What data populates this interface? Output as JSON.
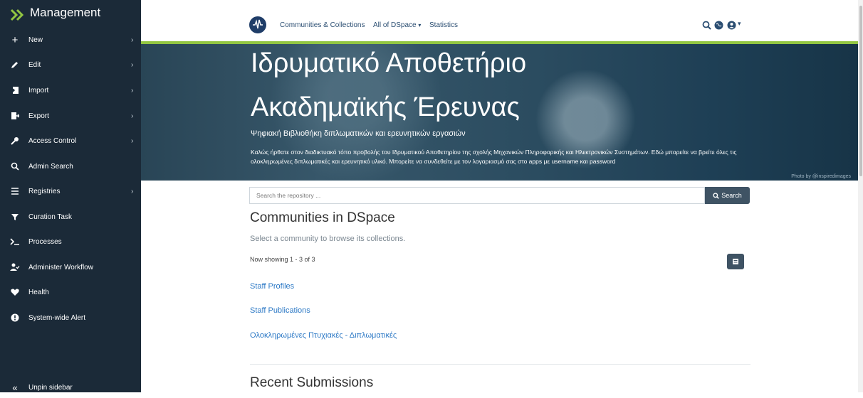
{
  "sidebar": {
    "title": "Management",
    "items": [
      {
        "label": "New",
        "icon": "plus-icon",
        "has_submenu": true
      },
      {
        "label": "Edit",
        "icon": "pencil-icon",
        "has_submenu": true
      },
      {
        "label": "Import",
        "icon": "import-icon",
        "has_submenu": true
      },
      {
        "label": "Export",
        "icon": "export-icon",
        "has_submenu": true
      },
      {
        "label": "Access Control",
        "icon": "key-icon",
        "has_submenu": true
      },
      {
        "label": "Admin Search",
        "icon": "search-icon",
        "has_submenu": false
      },
      {
        "label": "Registries",
        "icon": "list-icon",
        "has_submenu": true
      },
      {
        "label": "Curation Task",
        "icon": "filter-icon",
        "has_submenu": false
      },
      {
        "label": "Processes",
        "icon": "terminal-icon",
        "has_submenu": false
      },
      {
        "label": "Administer Workflow",
        "icon": "user-check-icon",
        "has_submenu": false
      },
      {
        "label": "Health",
        "icon": "heartbeat-icon",
        "has_submenu": false
      },
      {
        "label": "System-wide Alert",
        "icon": "alert-circle-icon",
        "has_submenu": false
      }
    ],
    "unpin_label": "Unpin sidebar",
    "chevron": "›"
  },
  "navbar": {
    "links": [
      "Communities & Collections",
      "All of DSpace",
      "Statistics"
    ],
    "dropdown_caret": "▾"
  },
  "banner": {
    "title_line1": "Ιδρυματικό Αποθετήριο",
    "title_line2": "Ακαδημαϊκής Έρευνας",
    "subtitle": "Ψηφιακή Βιβλιοθήκη διπλωματικών και ερευνητικών εργασιών",
    "welcome": "Καλώς ήρθατε στον διαδικτυακό τόπο προβολής του Ιδρυματικού Αποθετηρίου της σχολής Μηχανικών Πληροφορικής και Ηλεκτρονικών Συστημάτων. Εδώ μπορείτε να βρείτε όλες τις ολοκληρωμένες διπλωματικές και ερευνητικό υλικό. Μπορείτε να συνδεθείτε με τον λογαριασμό σας στο apps με username και password",
    "credit": "Photo by @inspiredimages"
  },
  "search": {
    "placeholder": "Search the repository ...",
    "button_label": "Search"
  },
  "main": {
    "heading": "Communities in DSpace",
    "description": "Select a community to browse its collections.",
    "showing": "Now showing 1 - 3 of 3",
    "communities": [
      "Staff Profiles",
      "Staff Publications",
      "Ολοκληρωμένες Πτυχιακές - Διπλωματικές"
    ],
    "recent_heading": "Recent Submissions"
  },
  "colors": {
    "sidebar_bg": "#1b2a38",
    "accent_green": "#92c642",
    "link": "#2b78c5",
    "button_dark": "#3f5364"
  }
}
